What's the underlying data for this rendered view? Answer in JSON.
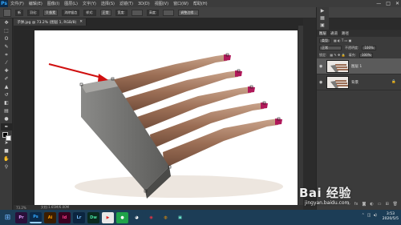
{
  "app": {
    "logo": "Ps",
    "menus": [
      "文件(F)",
      "编辑(E)",
      "图像(I)",
      "图层(L)",
      "文字(Y)",
      "选择(S)",
      "滤镜(T)",
      "3D(D)",
      "视图(V)",
      "窗口(W)",
      "帮助(H)"
    ],
    "window_controls": [
      "—",
      "□",
      "✕"
    ]
  },
  "options_bar": {
    "mode_select": "新",
    "feather_label": "羽化:",
    "feather_value": "0 像素",
    "anti_alias": "消除锯齿",
    "style_label": "样式:",
    "style_value": "正常",
    "width_label": "宽度:",
    "height_label": "高度:",
    "refine_button": "调整边缘..."
  },
  "document": {
    "tab_title": "子弹.jpg @ 73.2% (图层 1, RGB/8)",
    "tab_close": "✕",
    "zoom": "73.2%",
    "doc_info": "文档:1.65M/6.00M"
  },
  "layers_panel": {
    "tabs": [
      "图层",
      "通道",
      "路径"
    ],
    "kind_label": "类型",
    "blend_mode": "正常",
    "opacity_label": "不透明度:",
    "opacity_value": "100%",
    "lock_label": "锁定:",
    "fill_label": "填充:",
    "fill_value": "100%",
    "layers": [
      {
        "name": "图层 1",
        "selected": true
      },
      {
        "name": "背景",
        "selected": false
      }
    ],
    "bottom_icons": [
      "link-icon",
      "fx-icon",
      "mask-icon",
      "adjustment-icon",
      "folder-icon",
      "new-layer-icon",
      "trash-icon"
    ]
  },
  "toolbar": {
    "tools": [
      "move-tool",
      "marquee-tool",
      "lasso-tool",
      "quick-select-tool",
      "crop-tool",
      "eyedropper-tool",
      "healing-tool",
      "brush-tool",
      "stamp-tool",
      "history-brush-tool",
      "eraser-tool",
      "gradient-tool",
      "blur-tool",
      "dodge-tool",
      "pen-tool",
      "type-tool",
      "path-select-tool",
      "shape-tool",
      "hand-tool",
      "zoom-tool"
    ]
  },
  "taskbar": {
    "apps": [
      {
        "label": "Pr",
        "color": "#2a0f3a",
        "fg": "#e0a3ff"
      },
      {
        "label": "Ps",
        "color": "#0b2a4a",
        "fg": "#31a8ff",
        "active": true
      },
      {
        "label": "Ai",
        "color": "#3a1d00",
        "fg": "#ff9a00"
      },
      {
        "label": "Id",
        "color": "#3a0020",
        "fg": "#ff3d8b"
      },
      {
        "label": "Lr",
        "color": "#0b2540",
        "fg": "#7bc3ff"
      },
      {
        "label": "Dw",
        "color": "#0a2a1e",
        "fg": "#48e0a0"
      }
    ],
    "clock_time": "3:53",
    "clock_date": "2020/5/5"
  },
  "watermark": {
    "brand": "Bai 经验",
    "url": "jingyan.baidu.com"
  },
  "colors": {
    "arrow": "#d01010",
    "canvas_bg": "#ffffff",
    "ui_dark": "#2b2b2b"
  }
}
